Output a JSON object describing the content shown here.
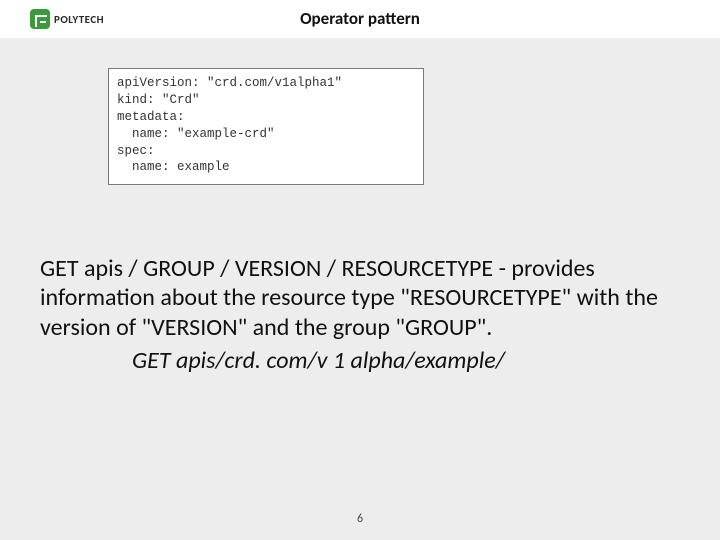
{
  "header": {
    "logo_text": "POLYTECH",
    "title": "Operator pattern"
  },
  "code": {
    "content": "apiVersion: \"crd.com/v1alpha1\"\nkind: \"Crd\"\nmetadata:\n  name: \"example-crd\"\nspec:\n  name: example"
  },
  "body": {
    "paragraph": "GET apis / GROUP / VERSION / RESOURCETYPE - provides information about the resource type \"RESOURCETYPE\" with the version of \"VERSION\" and the group \"GROUP\".",
    "example": "GET apis/crd. com/v 1 alpha/example/"
  },
  "page_number": "6"
}
